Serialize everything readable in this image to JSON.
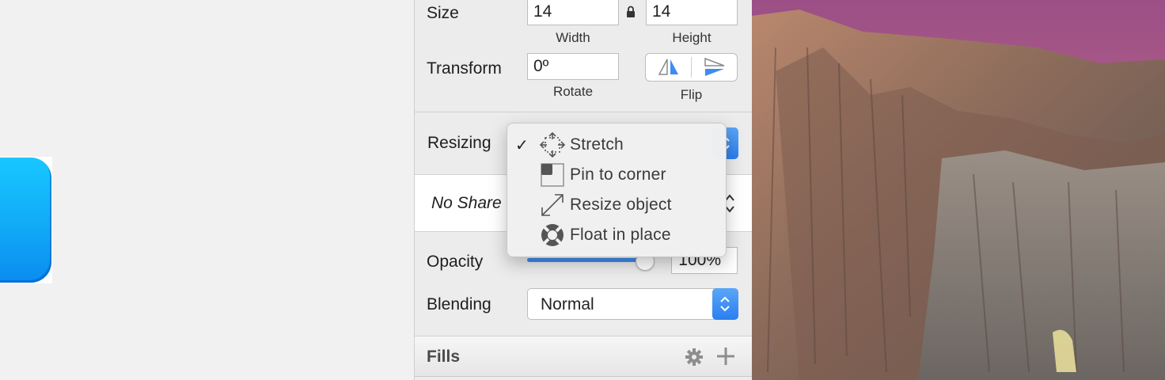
{
  "inspector": {
    "size": {
      "label": "Size",
      "width_value": "14",
      "height_value": "14",
      "width_caption": "Width",
      "height_caption": "Height"
    },
    "transform": {
      "label": "Transform",
      "rotate_value": "0º",
      "rotate_caption": "Rotate",
      "flip_caption": "Flip"
    },
    "resizing": {
      "label": "Resizing"
    },
    "shared_style": {
      "value": "No Share"
    },
    "opacity": {
      "label": "Opacity",
      "value": "100%",
      "level": 1.0
    },
    "blending": {
      "label": "Blending",
      "value": "Normal"
    },
    "fills": {
      "title": "Fills"
    }
  },
  "resizing_menu": {
    "items": [
      {
        "label": "Stretch",
        "icon": "stretch-arrows-icon",
        "checked": true
      },
      {
        "label": "Pin to corner",
        "icon": "pin-corner-icon",
        "checked": false
      },
      {
        "label": "Resize object",
        "icon": "resize-diagonal-icon",
        "checked": false
      },
      {
        "label": "Float in place",
        "icon": "lifebuoy-icon",
        "checked": false
      }
    ],
    "check_mark": "✓"
  },
  "colors": {
    "accent": "#2b7ff0",
    "shape_fill": "#11aaf7",
    "panel_bg": "#ececec"
  }
}
